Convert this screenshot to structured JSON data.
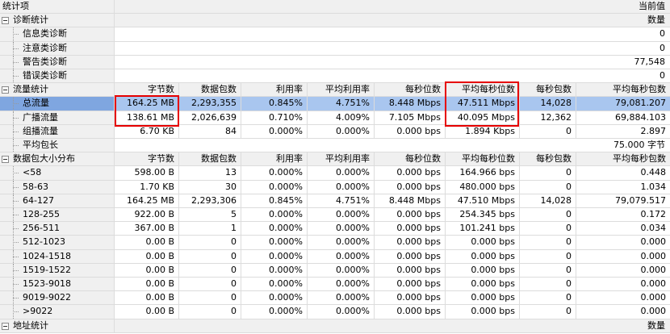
{
  "header": {
    "label": "统计项",
    "value_title": "当前值"
  },
  "diag": {
    "title": "诊断统计",
    "col": "数量",
    "items": [
      {
        "label": "信息类诊断",
        "value": "0"
      },
      {
        "label": "注意类诊断",
        "value": "0"
      },
      {
        "label": "警告类诊断",
        "value": "77,548"
      },
      {
        "label": "错误类诊断",
        "value": "0"
      }
    ]
  },
  "flow": {
    "title": "流量统计",
    "cols": [
      "字节数",
      "数据包数",
      "利用率",
      "平均利用率",
      "每秒位数",
      "平均每秒位数",
      "每秒包数",
      "平均每秒包数"
    ],
    "rows": [
      {
        "label": "总流量",
        "v": [
          "164.25 MB",
          "2,293,355",
          "0.845%",
          "4.751%",
          "8.448 Mbps",
          "47.511 Mbps",
          "14,028",
          "79,081.207"
        ]
      },
      {
        "label": "广播流量",
        "v": [
          "138.61 MB",
          "2,026,639",
          "0.710%",
          "4.009%",
          "7.105 Mbps",
          "40.095 Mbps",
          "12,362",
          "69,884.103"
        ]
      },
      {
        "label": "组播流量",
        "v": [
          "6.70 KB",
          "84",
          "0.000%",
          "0.000%",
          "0.000 bps",
          "1.894 Kbps",
          "0",
          "2.897"
        ]
      }
    ],
    "avg": {
      "label": "平均包长",
      "value": "75.000 字节"
    }
  },
  "size": {
    "title": "数据包大小分布",
    "cols": [
      "字节数",
      "数据包数",
      "利用率",
      "平均利用率",
      "每秒位数",
      "平均每秒位数",
      "每秒包数",
      "平均每秒包数"
    ],
    "rows": [
      {
        "label": "<58",
        "v": [
          "598.00 B",
          "13",
          "0.000%",
          "0.000%",
          "0.000 bps",
          "164.966 bps",
          "0",
          "0.448"
        ]
      },
      {
        "label": "58-63",
        "v": [
          "1.70 KB",
          "30",
          "0.000%",
          "0.000%",
          "0.000 bps",
          "480.000 bps",
          "0",
          "1.034"
        ]
      },
      {
        "label": "64-127",
        "v": [
          "164.25 MB",
          "2,293,306",
          "0.845%",
          "4.751%",
          "8.448 Mbps",
          "47.510 Mbps",
          "14,028",
          "79,079.517"
        ]
      },
      {
        "label": "128-255",
        "v": [
          "922.00 B",
          "5",
          "0.000%",
          "0.000%",
          "0.000 bps",
          "254.345 bps",
          "0",
          "0.172"
        ]
      },
      {
        "label": "256-511",
        "v": [
          "367.00 B",
          "1",
          "0.000%",
          "0.000%",
          "0.000 bps",
          "101.241 bps",
          "0",
          "0.034"
        ]
      },
      {
        "label": "512-1023",
        "v": [
          "0.00 B",
          "0",
          "0.000%",
          "0.000%",
          "0.000 bps",
          "0.000 bps",
          "0",
          "0.000"
        ]
      },
      {
        "label": "1024-1518",
        "v": [
          "0.00 B",
          "0",
          "0.000%",
          "0.000%",
          "0.000 bps",
          "0.000 bps",
          "0",
          "0.000"
        ]
      },
      {
        "label": "1519-1522",
        "v": [
          "0.00 B",
          "0",
          "0.000%",
          "0.000%",
          "0.000 bps",
          "0.000 bps",
          "0",
          "0.000"
        ]
      },
      {
        "label": "1523-9018",
        "v": [
          "0.00 B",
          "0",
          "0.000%",
          "0.000%",
          "0.000 bps",
          "0.000 bps",
          "0",
          "0.000"
        ]
      },
      {
        "label": "9019-9022",
        "v": [
          "0.00 B",
          "0",
          "0.000%",
          "0.000%",
          "0.000 bps",
          "0.000 bps",
          "0",
          "0.000"
        ]
      },
      {
        "label": ">9022",
        "v": [
          "0.00 B",
          "0",
          "0.000%",
          "0.000%",
          "0.000 bps",
          "0.000 bps",
          "0",
          "0.000"
        ]
      }
    ]
  },
  "addr": {
    "title": "地址统计",
    "col": "数量"
  }
}
